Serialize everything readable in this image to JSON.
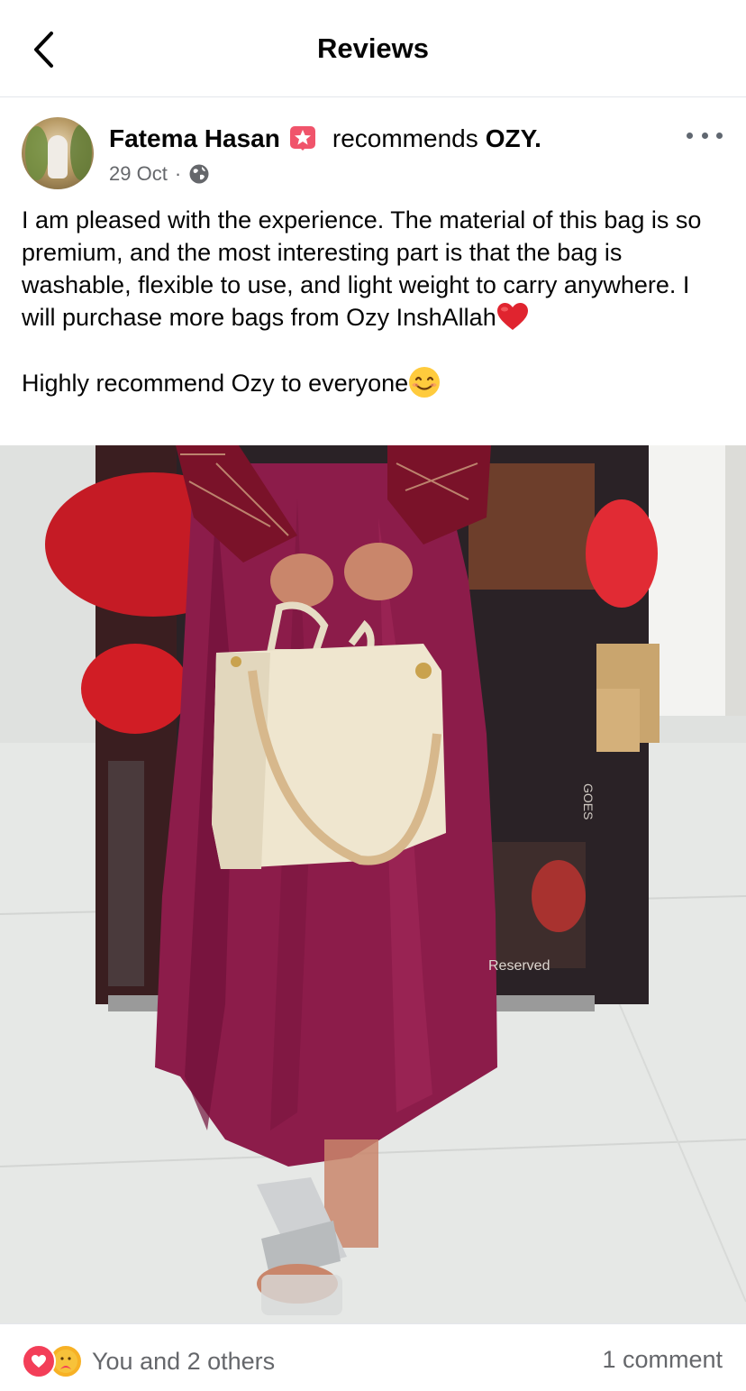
{
  "topbar": {
    "title": "Reviews",
    "back_icon": "chevron-left-icon"
  },
  "post": {
    "author": {
      "name": "Fatema Hasan",
      "badge_icon": "top-fan-star-icon"
    },
    "action_text": "recommends",
    "page_name": "OZY.",
    "date": "29 Oct",
    "separator": "·",
    "privacy_icon": "globe-icon",
    "more_icon": "more-dots-icon",
    "text_paragraph_1": "I am pleased with the experience. The material of this bag is so premium, and the most interesting part is that the bag is washable, flexible to use, and light weight to carry anywhere. I will purchase more bags from Ozy InshAllah",
    "text_paragraph_2": "Highly recommend Ozy to everyone",
    "photo_overlay_text_1": "Reserved",
    "photo_overlay_text_2": "GOES"
  },
  "footer": {
    "reaction_icons": [
      "love-reaction-icon",
      "care-reaction-icon"
    ],
    "reactions_text": "You and 2 others",
    "comments_text": "1 comment"
  },
  "colors": {
    "text": "#050505",
    "secondary_text": "#65676b",
    "divider": "#e4e6eb",
    "love": "#f33e58",
    "care": "#f7b125",
    "dress": "#8c1c4a"
  }
}
